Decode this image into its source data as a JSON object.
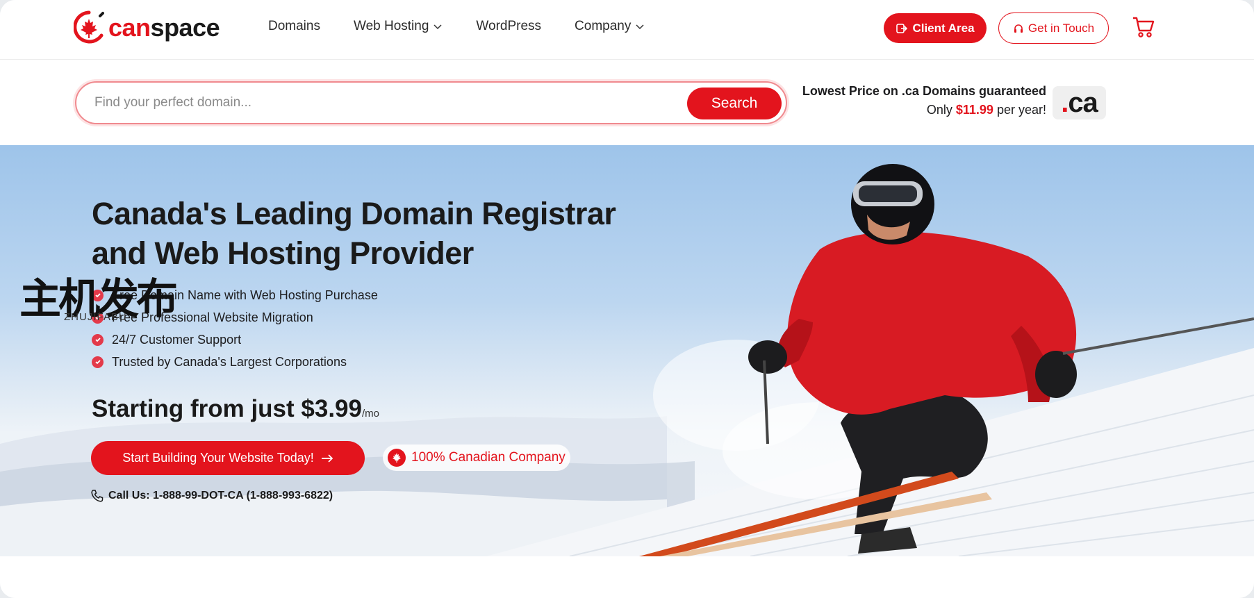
{
  "brand": {
    "part1": "can",
    "part2": "space"
  },
  "nav": [
    {
      "label": "Domains",
      "has_dropdown": false
    },
    {
      "label": "Web Hosting",
      "has_dropdown": true
    },
    {
      "label": "WordPress",
      "has_dropdown": false
    },
    {
      "label": "Company",
      "has_dropdown": true
    }
  ],
  "header_actions": {
    "client_area": "Client Area",
    "get_in_touch": "Get in Touch",
    "cart_icon": "cart-icon"
  },
  "search": {
    "placeholder": "Find your perfect domain...",
    "button": "Search"
  },
  "promo": {
    "line1": "Lowest Price on .ca Domains guaranteed",
    "prefix": "Only",
    "price": "$11.99",
    "suffix": "per year!",
    "badge_dot": ".",
    "badge_text": "ca"
  },
  "hero": {
    "title_line1": "Canada's Leading Domain Registrar",
    "title_line2": "and Web Hosting Provider",
    "features": [
      "Free Domain Name with Web Hosting Purchase",
      "Free Professional Website Migration",
      "24/7 Customer Support",
      "Trusted by Canada's Largest Corporations"
    ],
    "starting_text": "Starting from just $3.99",
    "per_month": "/mo",
    "cta": "Start Building Your Website Today!",
    "canadian_badge": "100% Canadian Company",
    "call": "Call Us: 1-888-99-DOT-CA (1-888-993-6822)"
  },
  "watermark": {
    "cn": "主机发布",
    "en": "ZHUJIFABU"
  },
  "colors": {
    "brand_red": "#e3141d",
    "text_dark": "#1a1a1a"
  }
}
